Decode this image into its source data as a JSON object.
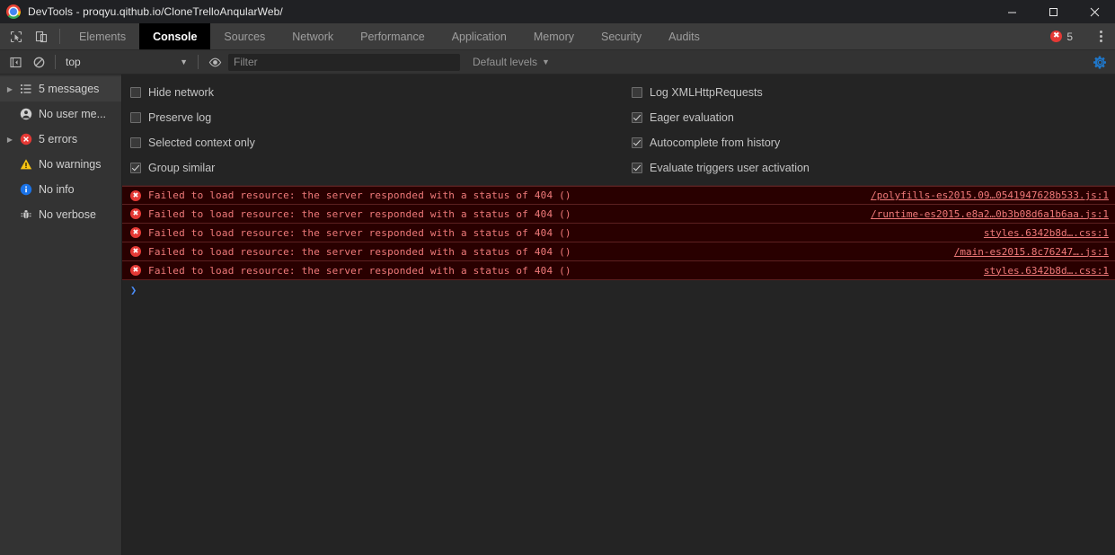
{
  "window": {
    "title": "DevTools - proqyu.qithub.io/CloneTrelloAnqularWeb/",
    "logo_icon": "chrome-logo-icon",
    "minimize_icon": "minimize-icon",
    "maximize_icon": "maximize-icon",
    "close_icon": "close-icon"
  },
  "tabbar": {
    "inspect_icon": "inspect-element-icon",
    "device_icon": "device-toolbar-icon",
    "tabs": [
      {
        "label": "Elements",
        "active": false
      },
      {
        "label": "Console",
        "active": true
      },
      {
        "label": "Sources",
        "active": false
      },
      {
        "label": "Network",
        "active": false
      },
      {
        "label": "Performance",
        "active": false
      },
      {
        "label": "Application",
        "active": false
      },
      {
        "label": "Memory",
        "active": false
      },
      {
        "label": "Security",
        "active": false
      },
      {
        "label": "Audits",
        "active": false
      }
    ],
    "error_badge": {
      "icon": "error-circle-icon",
      "glyph": "✖",
      "count": "5",
      "color": "#e53935"
    },
    "more_icon": "kebab-menu-icon"
  },
  "filterbar": {
    "sidebar_toggle_icon": "console-sidebar-toggle-icon",
    "clear_icon": "clear-console-icon",
    "context": {
      "value": "top",
      "caret": "▼"
    },
    "eye_icon": "live-expression-eye-icon",
    "filter": {
      "value": "",
      "placeholder": "Filter"
    },
    "levels": {
      "label": "Default levels",
      "caret": "▼"
    },
    "settings_icon": "settings-gear-icon",
    "settings_icon_color": "#1f76c8"
  },
  "sidebar": {
    "items": [
      {
        "label": "5 messages",
        "icon": "message-list-icon",
        "arrow": "▶",
        "selected": true
      },
      {
        "label": "No user me...",
        "icon": "user-message-icon",
        "arrow": "",
        "selected": false
      },
      {
        "label": "5 errors",
        "icon": "error-circle-icon",
        "arrow": "▶",
        "selected": false
      },
      {
        "label": "No warnings",
        "icon": "warning-triangle-icon",
        "arrow": "",
        "selected": false
      },
      {
        "label": "No info",
        "icon": "info-circle-icon",
        "arrow": "",
        "selected": false
      },
      {
        "label": "No verbose",
        "icon": "verbose-bug-icon",
        "arrow": "",
        "selected": false
      }
    ]
  },
  "settings_panel": {
    "left": [
      {
        "label": "Hide network",
        "checked": false
      },
      {
        "label": "Preserve log",
        "checked": false
      },
      {
        "label": "Selected context only",
        "checked": false
      },
      {
        "label": "Group similar",
        "checked": true
      }
    ],
    "right": [
      {
        "label": "Log XMLHttpRequests",
        "checked": false
      },
      {
        "label": "Eager evaluation",
        "checked": true
      },
      {
        "label": "Autocomplete from history",
        "checked": true
      },
      {
        "label": "Evaluate triggers user activation",
        "checked": true
      }
    ]
  },
  "console": {
    "messages": [
      {
        "level": "error",
        "glyph": "✖",
        "text": "Failed to load resource: the server responded with a status of 404 ()",
        "source": "/polyfills-es2015.09…0541947628b533.js:1"
      },
      {
        "level": "error",
        "glyph": "✖",
        "text": "Failed to load resource: the server responded with a status of 404 ()",
        "source": "/runtime-es2015.e8a2…0b3b08d6a1b6aa.js:1"
      },
      {
        "level": "error",
        "glyph": "✖",
        "text": "Failed to load resource: the server responded with a status of 404 ()",
        "source": "styles.6342b8d….css:1"
      },
      {
        "level": "error",
        "glyph": "✖",
        "text": "Failed to load resource: the server responded with a status of 404 ()",
        "source": "/main-es2015.8c76247….js:1"
      },
      {
        "level": "error",
        "glyph": "✖",
        "text": "Failed to load resource: the server responded with a status of 404 ()",
        "source": "styles.6342b8d….css:1"
      }
    ],
    "prompt": "❯"
  },
  "colors": {
    "error_red": "#e53935",
    "error_bg": "#290000",
    "error_text": "#f07a7a",
    "accent_blue": "#1f76c8",
    "prompt_blue": "#4a8df8"
  }
}
